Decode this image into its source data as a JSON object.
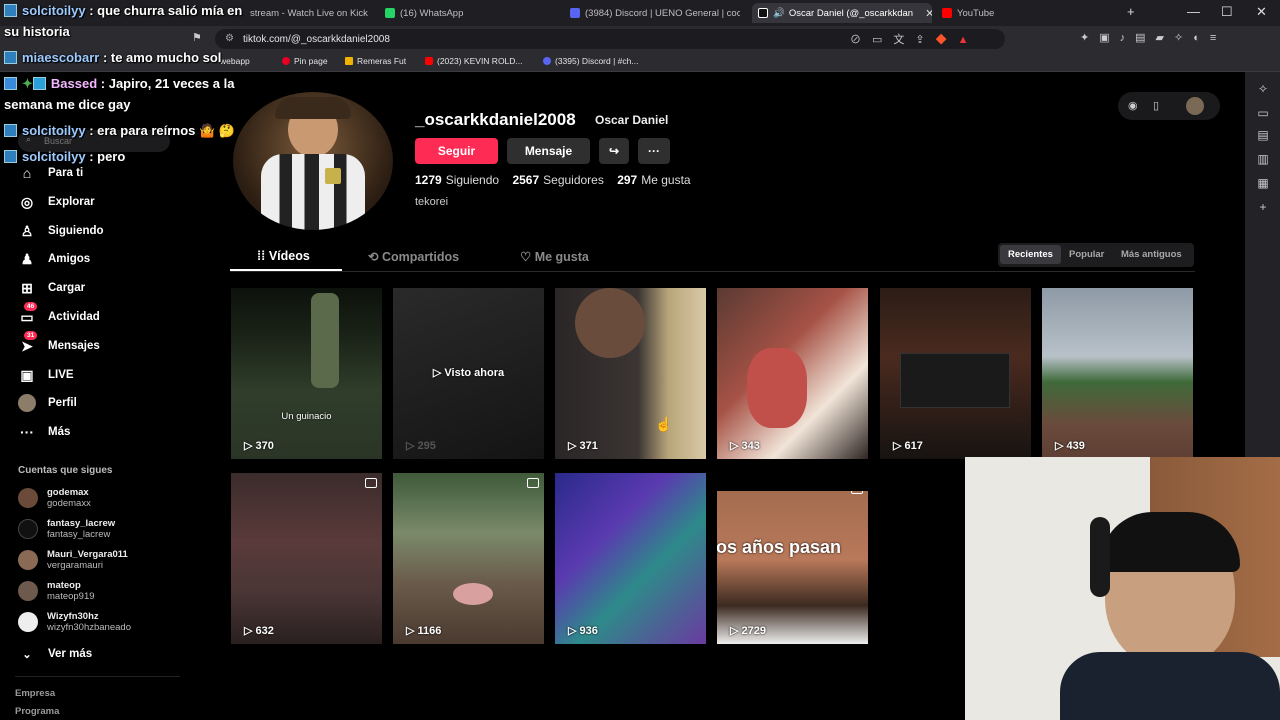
{
  "browser": {
    "tabs": [
      {
        "label": "stream - Watch Live on Kick",
        "color": "#53fc18"
      },
      {
        "label": "(16) WhatsApp",
        "color": "#25d366"
      },
      {
        "label": "(3984) Discord | UENO General | coo",
        "color": "#5865f2"
      },
      {
        "label": "Oscar Daniel (@_oscarkkdan",
        "color": "#ffffff"
      },
      {
        "label": "YouTube",
        "color": "#ff0000"
      }
    ],
    "url": "tiktok.com/@_oscarkkdaniel2008",
    "bookmarks": [
      {
        "label": "webapp",
        "color": "#25d366"
      },
      {
        "label": "Pin page",
        "color": "#e60023"
      },
      {
        "label": "Remeras Fut",
        "color": "#f2b200"
      },
      {
        "label": "(2023) KEVIN ROLD...",
        "color": "#ff0000"
      },
      {
        "label": "(3395) Discord | #ch...",
        "color": "#5865f2"
      }
    ]
  },
  "chat": [
    {
      "user": "solcitoilyy",
      "text": " : que churra salió mía en"
    },
    {
      "user": "",
      "text": "su historia"
    },
    {
      "user": "miaescobarr",
      "text": " : te amo mucho sol"
    },
    {
      "user": "Bassed",
      "text": " : Japiro, 21 veces a la"
    },
    {
      "user": "",
      "text": "semana me dice gay"
    },
    {
      "user": "solcitoilyy",
      "text": " : era para reírnos 🤷 🤔"
    },
    {
      "user": "solcitoilyy",
      "text": " : pero"
    }
  ],
  "sidebar": {
    "search_placeholder": "Buscar",
    "nav": [
      {
        "label": "Para ti",
        "icon": "home-icon",
        "glyph": "⌂"
      },
      {
        "label": "Explorar",
        "icon": "compass-icon",
        "glyph": "◎"
      },
      {
        "label": "Siguiendo",
        "icon": "following-icon",
        "glyph": "♙"
      },
      {
        "label": "Amigos",
        "icon": "friends-icon",
        "glyph": "♟"
      },
      {
        "label": "Cargar",
        "icon": "upload-icon",
        "glyph": "⊞"
      },
      {
        "label": "Actividad",
        "icon": "activity-icon",
        "glyph": "▭",
        "badge": "46"
      },
      {
        "label": "Mensajes",
        "icon": "messages-icon",
        "glyph": "➤",
        "badge": "31"
      },
      {
        "label": "LIVE",
        "icon": "live-icon",
        "glyph": "▣"
      },
      {
        "label": "Perfil",
        "icon": "profile-icon",
        "glyph": "●"
      },
      {
        "label": "Más",
        "icon": "more-icon",
        "glyph": "···"
      }
    ],
    "following_title": "Cuentas que sigues",
    "following": [
      {
        "name": "godemax",
        "handle": "godemaxx",
        "color": "#6b4a3a"
      },
      {
        "name": "fantasy_lacrew",
        "handle": "fantasy_lacrew",
        "color": "#111111"
      },
      {
        "name": "Mauri_Vergara011",
        "handle": "vergaramauri",
        "color": "#8a6a55"
      },
      {
        "name": "mateop",
        "handle": "mateop919",
        "color": "#6d5a4c"
      },
      {
        "name": "Wizyfn30hz",
        "handle": "wizyfn30hzbaneado",
        "color": "#eeeeee"
      }
    ],
    "see_more": "Ver más",
    "footer": [
      "Empresa",
      "Programa"
    ]
  },
  "profile": {
    "username": "_oscarkkdaniel2008",
    "nickname": "Oscar Daniel",
    "follow_label": "Seguir",
    "message_label": "Mensaje",
    "following_count": "1279",
    "following_label": "Siguiendo",
    "followers_count": "2567",
    "followers_label": "Seguidores",
    "likes_count": "297",
    "likes_label": "Me gusta",
    "bio": "tekorei",
    "accent": "#fe2c55"
  },
  "content_tabs": {
    "videos": "Vídeos",
    "shared": "Compartidos",
    "liked": "Me gusta",
    "sort": [
      "Recientes",
      "Popular",
      "Más antiguos"
    ]
  },
  "videos": [
    {
      "views": "370",
      "caption": "Un guinacio"
    },
    {
      "views": "295",
      "overlay": "Visto ahora"
    },
    {
      "views": "371"
    },
    {
      "views": "343"
    },
    {
      "views": "617"
    },
    {
      "views": "439"
    },
    {
      "views": "632"
    },
    {
      "views": "1166"
    },
    {
      "views": "936"
    },
    {
      "views": "2729",
      "caption": "os años pasan"
    }
  ]
}
